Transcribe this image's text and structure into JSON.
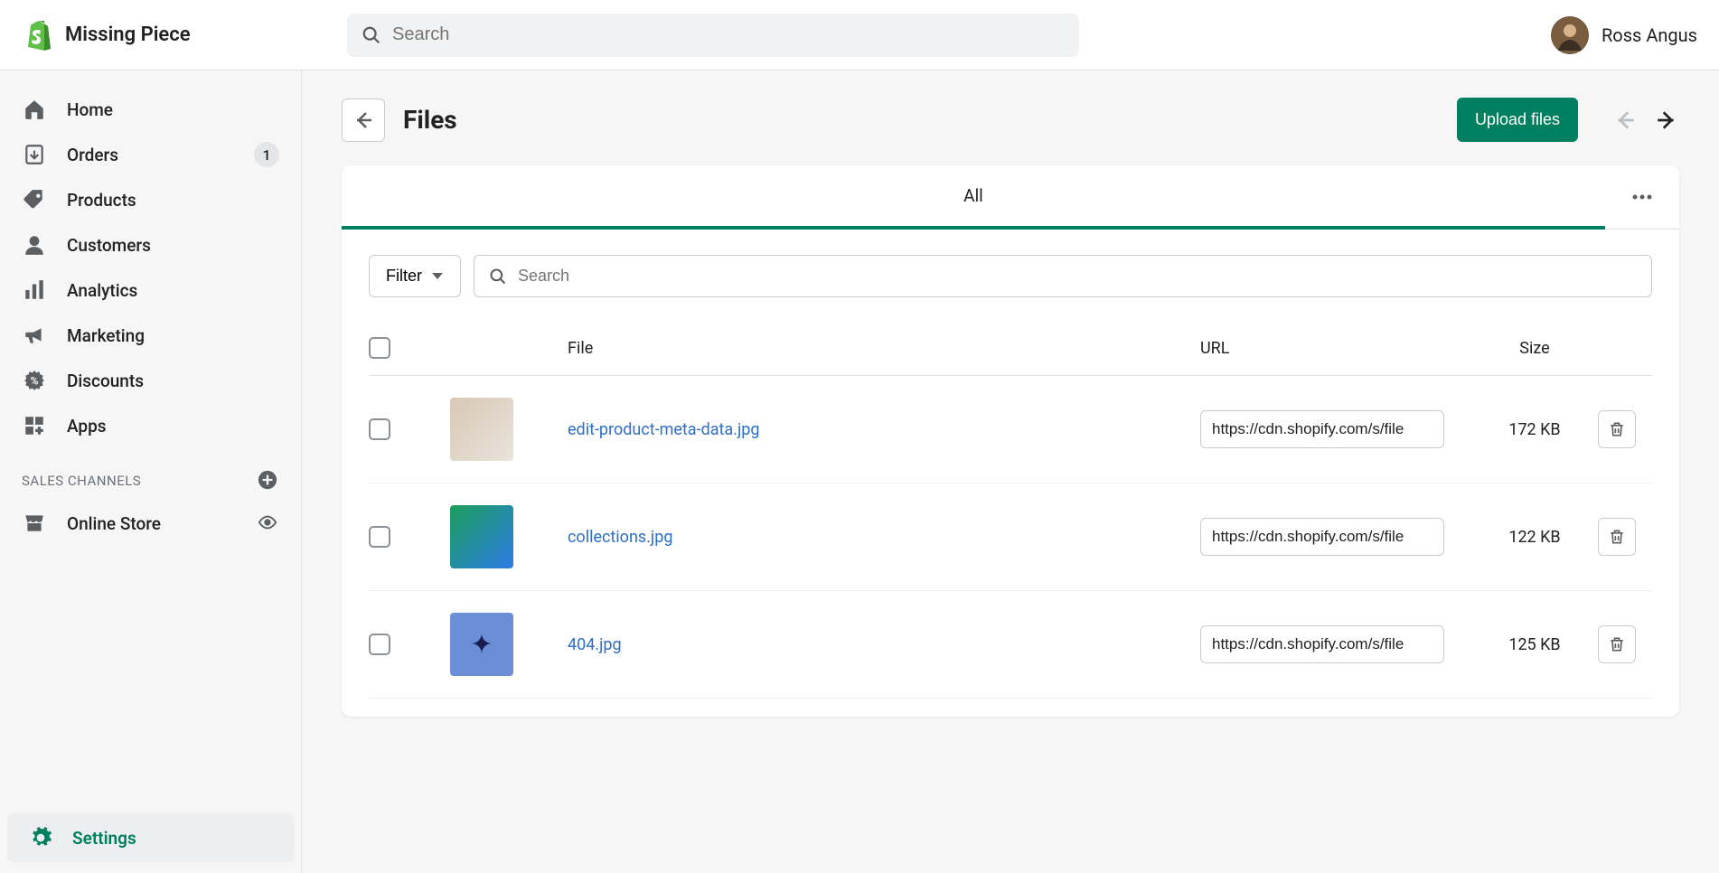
{
  "header": {
    "shop_name": "Missing Piece",
    "search_placeholder": "Search",
    "user_name": "Ross Angus"
  },
  "sidebar": {
    "items": [
      {
        "label": "Home",
        "icon": "home-icon",
        "badge": null
      },
      {
        "label": "Orders",
        "icon": "orders-icon",
        "badge": "1"
      },
      {
        "label": "Products",
        "icon": "products-icon",
        "badge": null
      },
      {
        "label": "Customers",
        "icon": "customers-icon",
        "badge": null
      },
      {
        "label": "Analytics",
        "icon": "analytics-icon",
        "badge": null
      },
      {
        "label": "Marketing",
        "icon": "marketing-icon",
        "badge": null
      },
      {
        "label": "Discounts",
        "icon": "discounts-icon",
        "badge": null
      },
      {
        "label": "Apps",
        "icon": "apps-icon",
        "badge": null
      }
    ],
    "channels_heading": "SALES CHANNELS",
    "channels": [
      {
        "label": "Online Store",
        "icon": "store-icon"
      }
    ],
    "settings_label": "Settings"
  },
  "page": {
    "title": "Files",
    "upload_label": "Upload files",
    "tab_all": "All",
    "filter_label": "Filter",
    "content_search_placeholder": "Search",
    "columns": {
      "file": "File",
      "url": "URL",
      "size": "Size"
    },
    "files": [
      {
        "name": "edit-product-meta-data.jpg",
        "url": "https://cdn.shopify.com/s/file",
        "size": "172 KB"
      },
      {
        "name": "collections.jpg",
        "url": "https://cdn.shopify.com/s/file",
        "size": "122 KB"
      },
      {
        "name": "404.jpg",
        "url": "https://cdn.shopify.com/s/file",
        "size": "125 KB"
      }
    ]
  }
}
